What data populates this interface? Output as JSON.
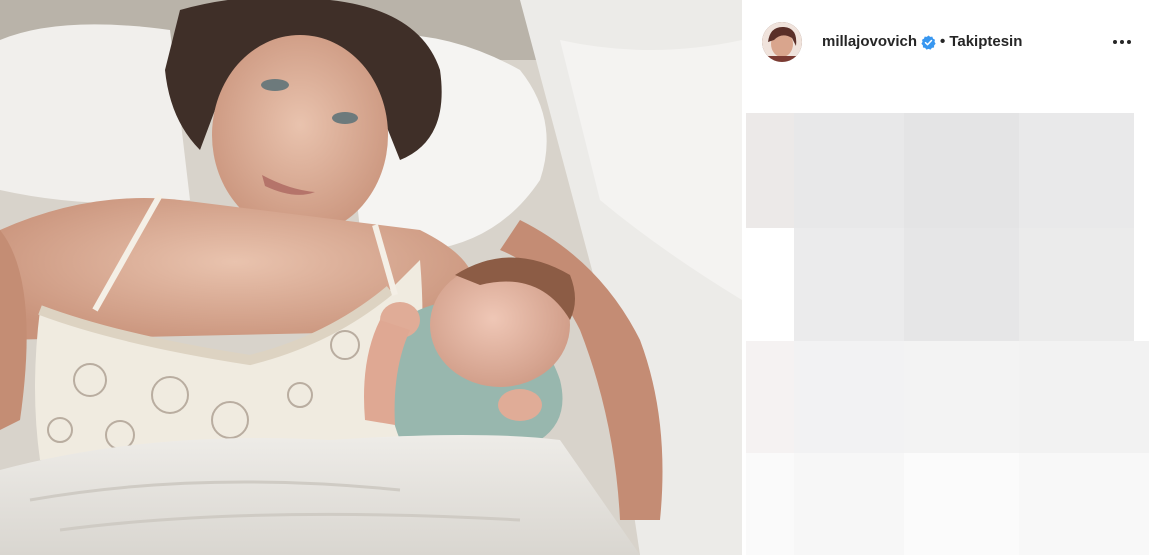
{
  "post": {
    "username": "millajovovich",
    "separator": "•",
    "follow_status": "Takiptesin",
    "verified": true
  },
  "icons": {
    "verified": "verified-badge-icon",
    "more": "more-options-icon"
  },
  "colors": {
    "verified_blue": "#3897f0",
    "text": "#262626"
  }
}
